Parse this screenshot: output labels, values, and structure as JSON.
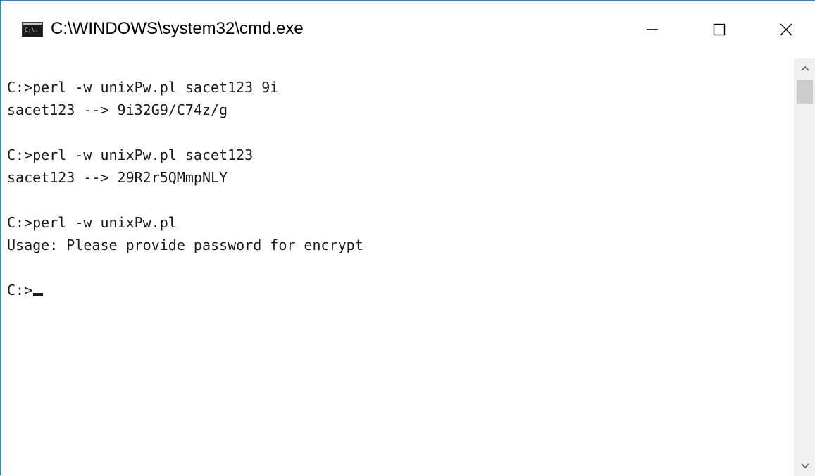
{
  "window": {
    "title": "C:\\WINDOWS\\system32\\cmd.exe",
    "app_icon_glyph": "C:\\."
  },
  "controls": {
    "minimize": "minimize-icon",
    "maximize": "maximize-icon",
    "close": "close-icon"
  },
  "console": {
    "lines": [
      "C:>perl -w unixPw.pl sacet123 9i",
      "sacet123 --> 9i32G9/C74z/g",
      "",
      "C:>perl -w unixPw.pl sacet123",
      "sacet123 --> 29R2r5QMmpNLY",
      "",
      "C:>perl -w unixPw.pl",
      "Usage: Please provide password for encrypt",
      "",
      "C:>"
    ]
  },
  "scrollbar": {
    "up_icon": "chevron-up-icon",
    "down_icon": "chevron-down-icon"
  }
}
